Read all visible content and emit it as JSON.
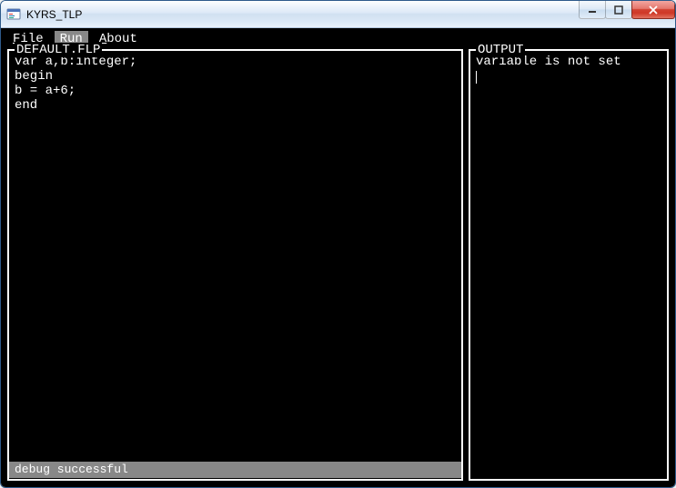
{
  "window": {
    "title": "KYRS_TLP"
  },
  "menu": {
    "file": "File",
    "run": "Run",
    "about": "About"
  },
  "panels": {
    "left": {
      "title": "DEFAULT.FLP",
      "content": "var a,b:integer;\nbegin\nb = a+6;\nend"
    },
    "right": {
      "title": "OUTPUT",
      "content": "variable is not set"
    }
  },
  "status": "debug successful"
}
